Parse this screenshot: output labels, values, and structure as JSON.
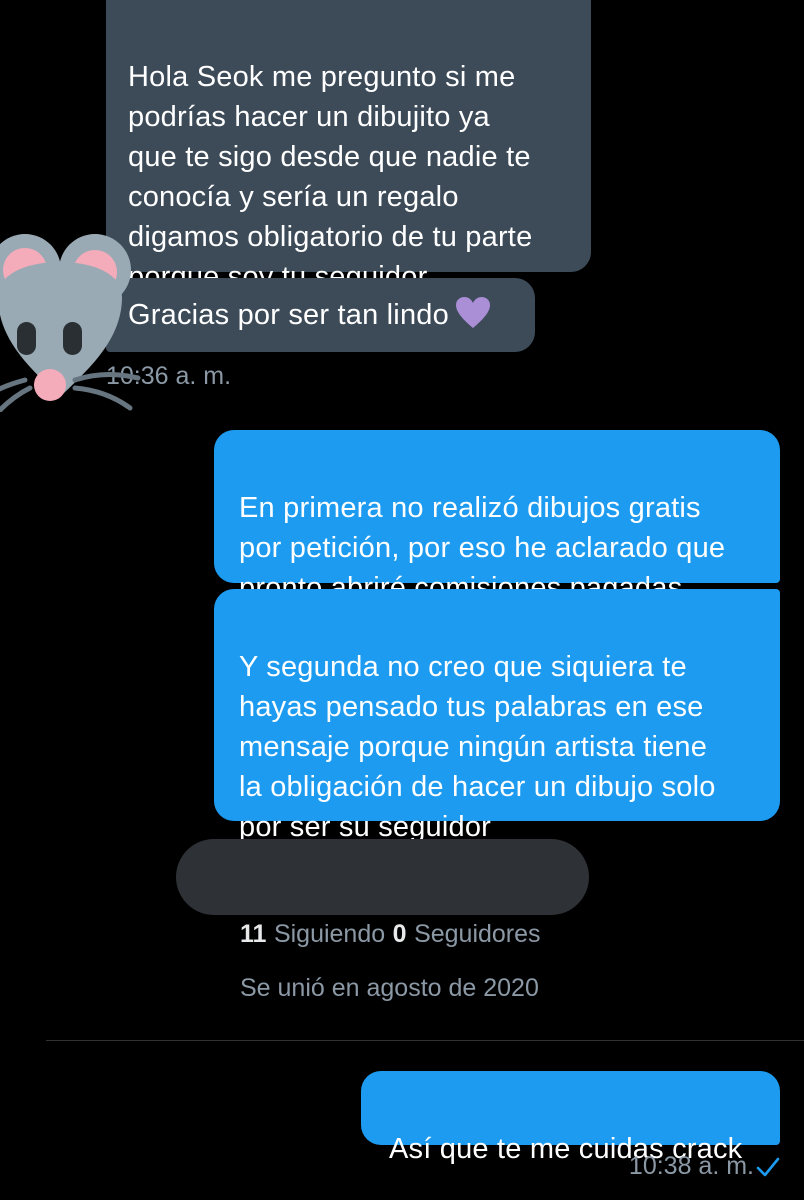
{
  "messages": {
    "incoming_1": "Hola Seok me pregunto si me\npodrías hacer un dibujito ya\nque te sigo desde que nadie te\nconocía y sería un regalo\ndigamos obligatorio de tu parte\nporque soy tu seguidor",
    "incoming_2": "Gracias por ser tan lindo",
    "incoming_time": "10:36 a. m.",
    "outgoing_1": "En primera no realizó dibujos gratis\npor petición, por eso he aclarado que\npronto abriré comisiones pagadas",
    "outgoing_2": "Y segunda no creo que siquiera te\nhayas pensado tus palabras en ese\nmensaje porque ningún artista tiene\nla obligación de hacer un dibujo solo\npor ser su seguidor",
    "outgoing_3": "Así que te me cuidas crack",
    "outgoing_time": "10:38 a. m."
  },
  "profile_card": {
    "following_count": "11",
    "following_label": "Siguiendo",
    "followers_count": "0",
    "followers_label": "Seguidores",
    "joined": "Se unió en agosto de 2020"
  },
  "icons": {
    "heart": "purple-heart-icon",
    "sticker": "mouse-face-icon",
    "read_receipt": "check-icon"
  },
  "colors": {
    "incoming_bubble": "#3d4b59",
    "outgoing_bubble": "#1d9bf0",
    "heart": "#aa8ed6",
    "muted_text": "#8b98a5",
    "redaction": "#2e3236"
  }
}
